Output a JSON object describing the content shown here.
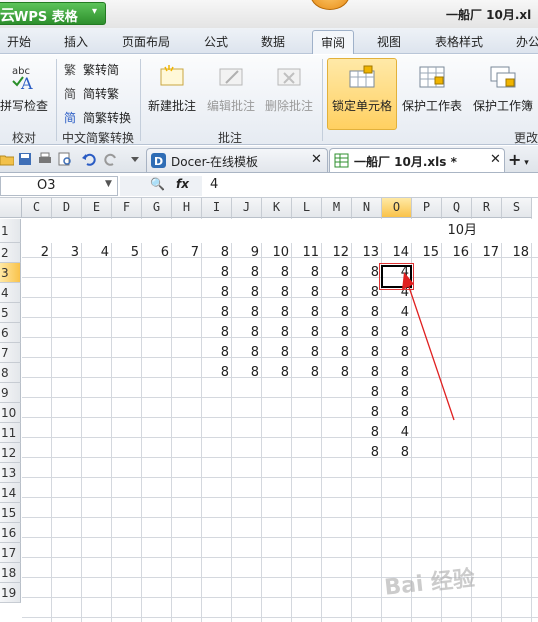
{
  "app": {
    "name": "WPS 表格",
    "logo": "云"
  },
  "window": {
    "title": "一船厂 10月.xl"
  },
  "menu": {
    "tabs": [
      "开始",
      "插入",
      "页面布局",
      "公式",
      "数据",
      "审阅",
      "视图",
      "表格样式",
      "办公"
    ],
    "active": "审阅"
  },
  "ribbon": {
    "proofing": {
      "spellcheck": "拼写检查",
      "group": "校对"
    },
    "chinese": {
      "trad_to_simp": "繁转简",
      "simp_to_trad": "简转繁",
      "convert": "简繁转换",
      "group": "中文简繁转换"
    },
    "comments": {
      "new": "新建批注",
      "edit": "编辑批注",
      "delete": "删除批注",
      "group": "批注"
    },
    "protect": {
      "lock_cell": "锁定单元格",
      "protect_sheet": "保护工作表",
      "protect_book": "保护工作簿",
      "group": "更改"
    }
  },
  "tabs": {
    "docer": "Docer-在线模板",
    "file": "一船厂 10月.xls *"
  },
  "formula": {
    "cell_ref": "O3",
    "value": "4",
    "fx": "fx"
  },
  "columns": [
    "C",
    "D",
    "E",
    "F",
    "G",
    "H",
    "I",
    "J",
    "K",
    "L",
    "M",
    "N",
    "O",
    "P",
    "Q",
    "R",
    "S"
  ],
  "rows": [
    "1",
    "2",
    "3",
    "4",
    "5",
    "6",
    "7",
    "8",
    "9",
    "10",
    "11",
    "12",
    "13",
    "14",
    "15",
    "16",
    "17",
    "18",
    "19"
  ],
  "sheet": {
    "month_label": "10月",
    "day_header": [
      "2",
      "3",
      "4",
      "5",
      "6",
      "7",
      "8",
      "9",
      "10",
      "11",
      "12",
      "13",
      "14",
      "15",
      "16",
      "17",
      "18"
    ],
    "data_rows": [
      [
        "",
        "",
        "",
        "",
        "",
        "",
        "8",
        "8",
        "8",
        "8",
        "8",
        "8",
        "4"
      ],
      [
        "",
        "",
        "",
        "",
        "",
        "",
        "8",
        "8",
        "8",
        "8",
        "8",
        "8",
        "4"
      ],
      [
        "",
        "",
        "",
        "",
        "",
        "",
        "8",
        "8",
        "8",
        "8",
        "8",
        "8",
        "4"
      ],
      [
        "",
        "",
        "",
        "",
        "",
        "",
        "8",
        "8",
        "8",
        "8",
        "8",
        "8",
        "8"
      ],
      [
        "",
        "",
        "",
        "",
        "",
        "",
        "8",
        "8",
        "8",
        "8",
        "8",
        "8",
        "8"
      ],
      [
        "",
        "",
        "",
        "",
        "",
        "",
        "8",
        "8",
        "8",
        "8",
        "8",
        "8",
        "8"
      ],
      [
        "",
        "",
        "",
        "",
        "",
        "",
        "",
        "",
        "",
        "",
        "",
        "8",
        "8"
      ],
      [
        "",
        "",
        "",
        "",
        "",
        "",
        "",
        "",
        "",
        "",
        "",
        "8",
        "8"
      ],
      [
        "",
        "",
        "",
        "",
        "",
        "",
        "",
        "",
        "",
        "",
        "",
        "8",
        "4"
      ],
      [
        "",
        "",
        "",
        "",
        "",
        "",
        "",
        "",
        "",
        "",
        "",
        "8",
        "8"
      ]
    ]
  },
  "watermark": "Bai 经验",
  "colors": {
    "accent": "#2e8f2c",
    "selection": "#f9c24a",
    "arrow": "#e02020"
  }
}
